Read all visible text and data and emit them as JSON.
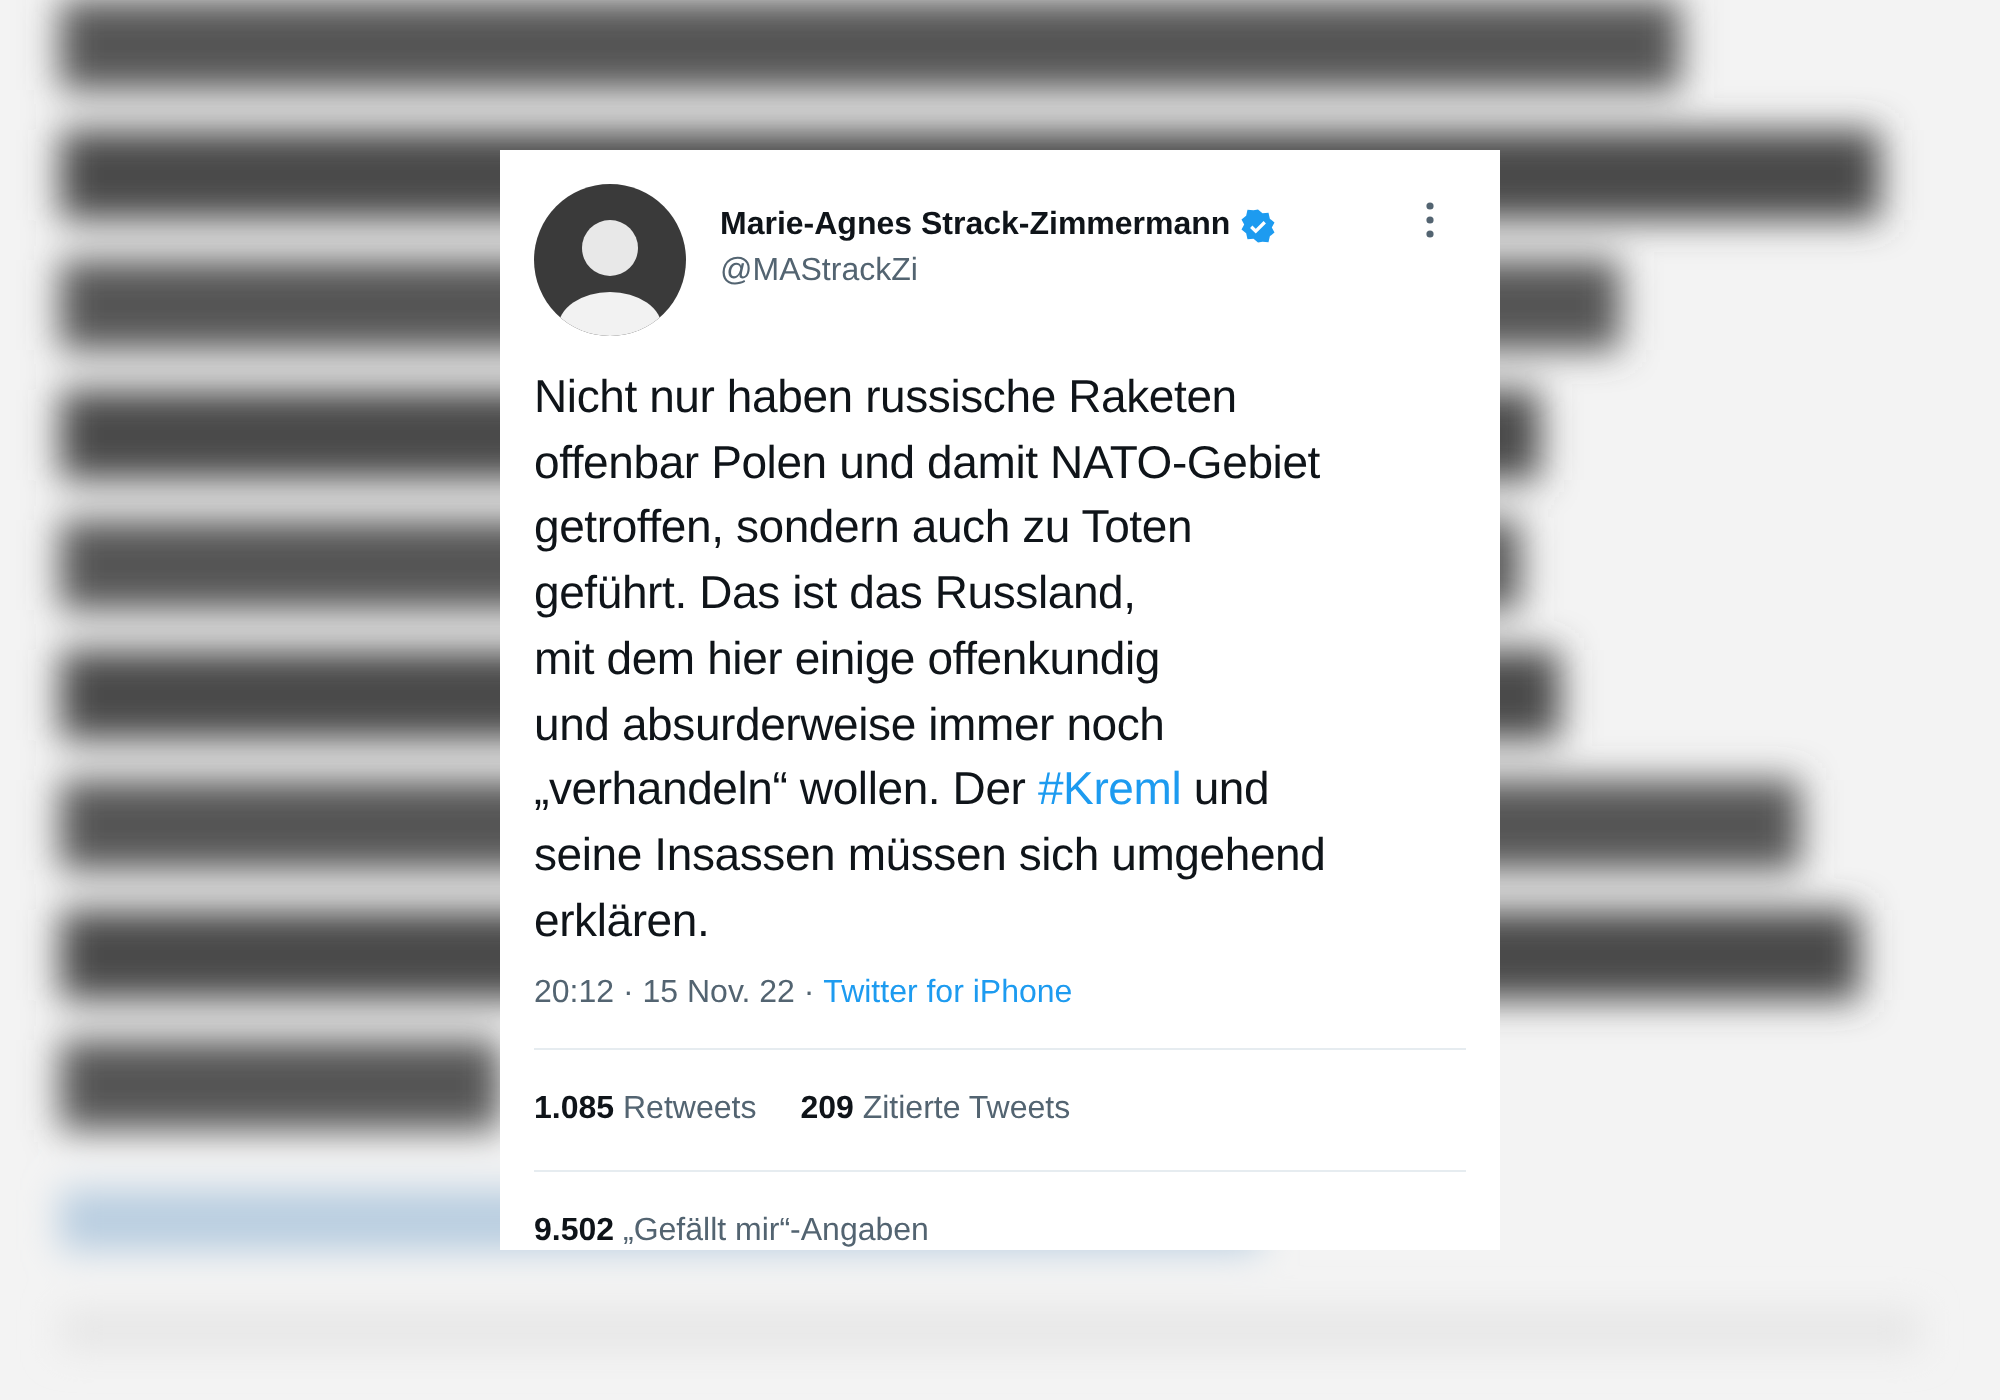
{
  "tweet": {
    "author": {
      "name": "Marie-Agnes Strack-Zimmermann",
      "handle": "@MAStrackZi",
      "verified": true
    },
    "text": [
      {
        "kind": "text",
        "value": "Nicht nur haben russische Raketen\noffenbar Polen und damit NATO-Gebiet\ngetroffen, sondern auch zu Toten\ngeführt. Das ist das Russland,\nmit dem hier einige offenkundig\nund absurderweise immer noch\n„verhandeln“ wollen. Der "
      },
      {
        "kind": "hashtag",
        "value": "#Kreml"
      },
      {
        "kind": "text",
        "value": " und\nseine Insassen müssen sich umgehend\nerklären."
      }
    ],
    "time": "20:12 · 15 Nov. 22 · ",
    "source": "Twitter for iPhone",
    "stats": [
      "**1.085** Retweets",
      "**209** Zitierte Tweets"
    ],
    "likes": "**9.502** „Gefällt mir“-Angaben"
  }
}
